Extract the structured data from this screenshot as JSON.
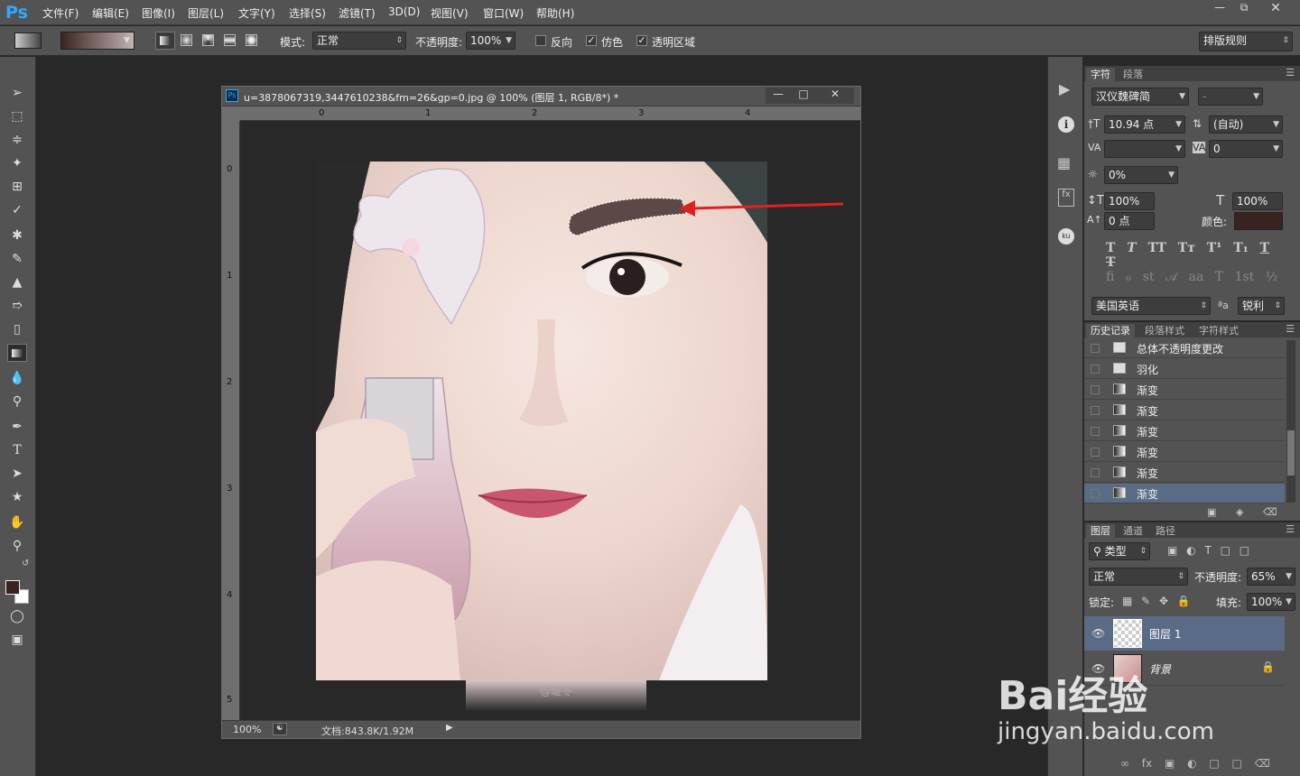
{
  "app": {
    "logo": "Ps"
  },
  "menu": [
    "文件(F)",
    "编辑(E)",
    "图像(I)",
    "图层(L)",
    "文字(Y)",
    "选择(S)",
    "滤镜(T)",
    "3D(D)",
    "视图(V)",
    "窗口(W)",
    "帮助(H)"
  ],
  "options": {
    "mode_label": "模式:",
    "mode_value": "正常",
    "opacity_label": "不透明度:",
    "opacity_value": "100%",
    "reverse": "反向",
    "dither": "仿色",
    "transparency": "透明区域",
    "workspace": "排版规则"
  },
  "document": {
    "title": "u=3878067319,3447610238&fm=26&gp=0.jpg @ 100% (图层 1, RGB/8*) *",
    "ruler_h": [
      "0",
      "1",
      "2",
      "3",
      "4"
    ],
    "ruler_v": [
      "0",
      "1",
      "2",
      "3",
      "4",
      "5"
    ],
    "zoom": "100%",
    "doc_size": "文档:843.8K/1.92M",
    "watermark": "@暖冬"
  },
  "character": {
    "tabs": [
      "字符",
      "段落"
    ],
    "font_family": "汉仪魏碑简",
    "font_style": "-",
    "size": "10.94 点",
    "leading": "(自动)",
    "kerning": "",
    "tracking": "0",
    "scale_pct": "0%",
    "vscale": "100%",
    "hscale": "100%",
    "baseline": "0 点",
    "color_label": "颜色:",
    "color": "#3a2220",
    "language": "美国英语",
    "aa": "锐利"
  },
  "history": {
    "tabs": [
      "历史记录",
      "段落样式",
      "字符样式"
    ],
    "items": [
      "总体不透明度更改",
      "羽化",
      "渐变",
      "渐变",
      "渐变",
      "渐变",
      "渐变",
      "渐变"
    ]
  },
  "layers": {
    "tabs": [
      "图层",
      "通道",
      "路径"
    ],
    "filter": "类型",
    "blend": "正常",
    "opacity_label": "不透明度:",
    "opacity": "65%",
    "lock_label": "锁定:",
    "fill_label": "填充:",
    "fill": "100%",
    "items": [
      "图层 1",
      "背景"
    ]
  },
  "overlay": {
    "brand": "Bai经验",
    "url": "jingyan.baidu.com"
  }
}
